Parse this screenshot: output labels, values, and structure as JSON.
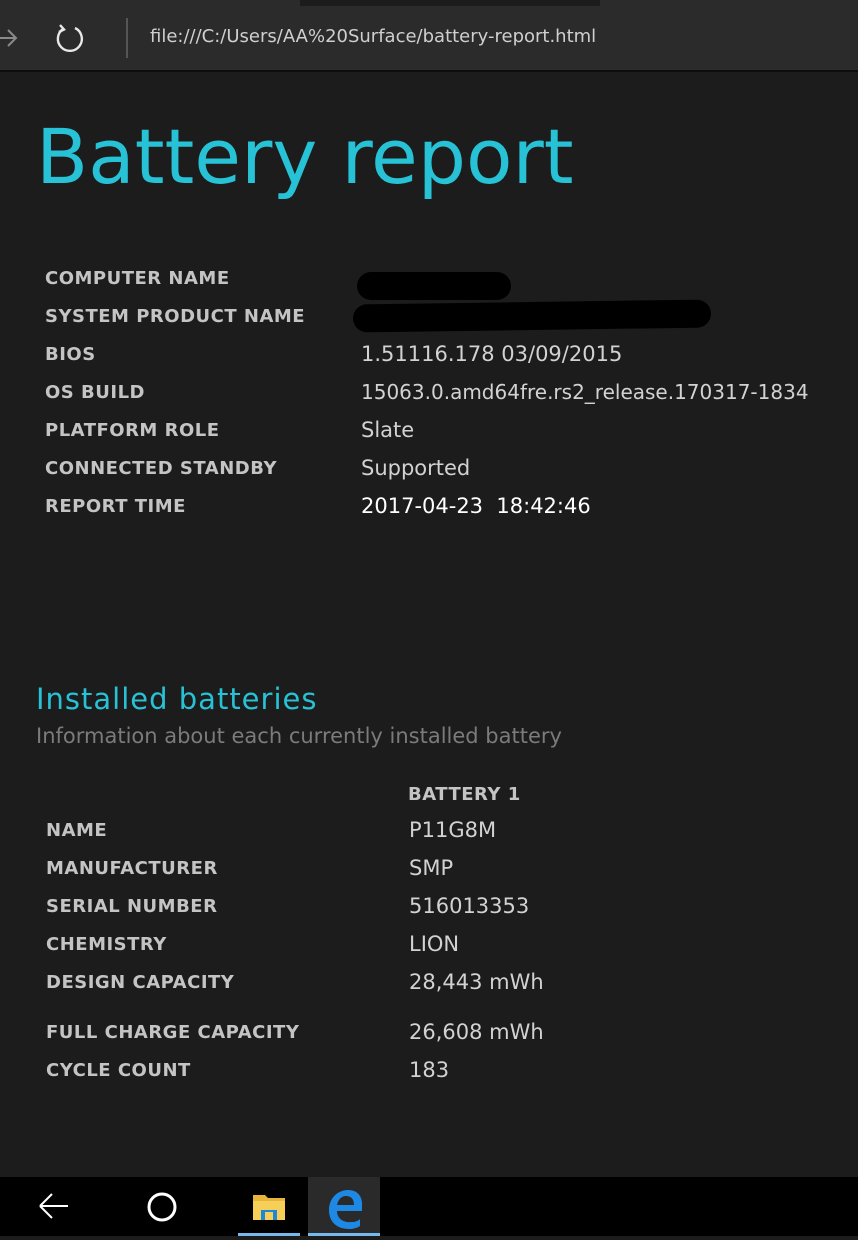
{
  "browser": {
    "url": "file:///C:/Users/AA%20Surface/battery-report.html"
  },
  "page": {
    "title": "Battery report",
    "system_info": [
      {
        "label": "COMPUTER NAME",
        "value": ""
      },
      {
        "label": "SYSTEM PRODUCT NAME",
        "value": ""
      },
      {
        "label": "BIOS",
        "value": "1.51116.178 03/09/2015"
      },
      {
        "label": "OS BUILD",
        "value": "15063.0.amd64fre.rs2_release.170317-1834"
      },
      {
        "label": "PLATFORM ROLE",
        "value": "Slate"
      },
      {
        "label": "CONNECTED STANDBY",
        "value": "Supported"
      },
      {
        "label": "REPORT TIME",
        "value": "2017-04-23  18:42:46"
      }
    ],
    "installed_batteries": {
      "title": "Installed batteries",
      "subtitle": "Information about each currently installed battery",
      "column_header": "BATTERY 1",
      "rows": [
        {
          "label": "NAME",
          "value": "P11G8M"
        },
        {
          "label": "MANUFACTURER",
          "value": "SMP"
        },
        {
          "label": "SERIAL NUMBER",
          "value": "516013353"
        },
        {
          "label": "CHEMISTRY",
          "value": "LION"
        },
        {
          "label": "DESIGN CAPACITY",
          "value": "28,443 mWh"
        },
        {
          "label": "FULL CHARGE CAPACITY",
          "value": "26,608 mWh"
        },
        {
          "label": "CYCLE COUNT",
          "value": "183"
        }
      ]
    }
  },
  "taskbar": {
    "items": [
      {
        "icon": "back-arrow-icon"
      },
      {
        "icon": "home-circle-icon"
      },
      {
        "icon": "file-explorer-icon"
      },
      {
        "icon": "edge-browser-icon"
      }
    ]
  },
  "colors": {
    "accent": "#27c2d6",
    "background": "#1c1c1c",
    "chrome": "#2b2b2b",
    "taskbar": "#000000"
  }
}
